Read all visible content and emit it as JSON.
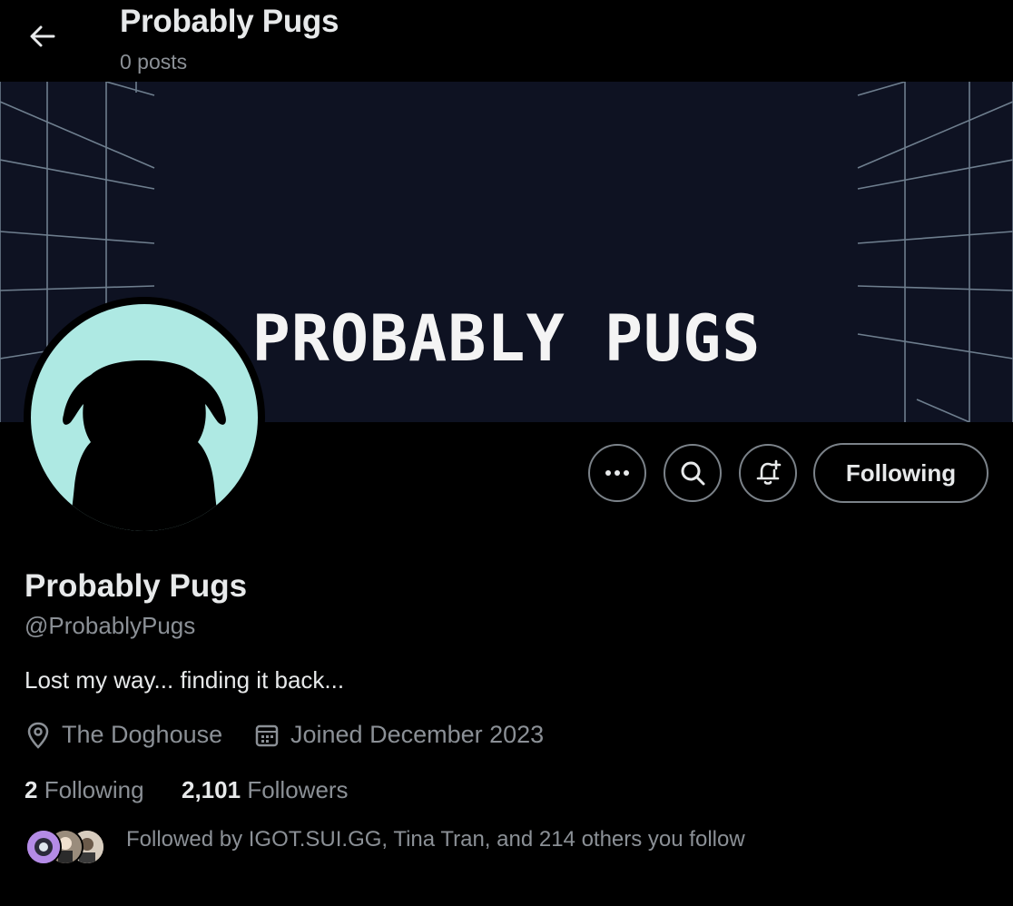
{
  "header": {
    "title": "Probably Pugs",
    "subtitle": "0 posts"
  },
  "banner": {
    "text": "PROBABLY PUGS"
  },
  "actions": {
    "more_icon": "more-horizontal-icon",
    "search_icon": "search-icon",
    "notify_icon": "bell-plus-icon",
    "following_label": "Following"
  },
  "profile": {
    "name": "Probably Pugs",
    "handle": "@ProbablyPugs",
    "bio": "Lost my way... finding it back...",
    "location": "The Doghouse",
    "joined": "Joined December 2023",
    "following_count": "2",
    "following_label": "Following",
    "followers_count": "2,101",
    "followers_label": "Followers",
    "followed_by": "Followed by IGOT.SUI.GG, Tina Tran, and 214 others you follow"
  },
  "colors": {
    "background": "#000000",
    "banner": "#0e1222",
    "avatar_bg": "#aee9e3",
    "muted_text": "#8b9096",
    "primary_text": "#e7e9ea"
  }
}
